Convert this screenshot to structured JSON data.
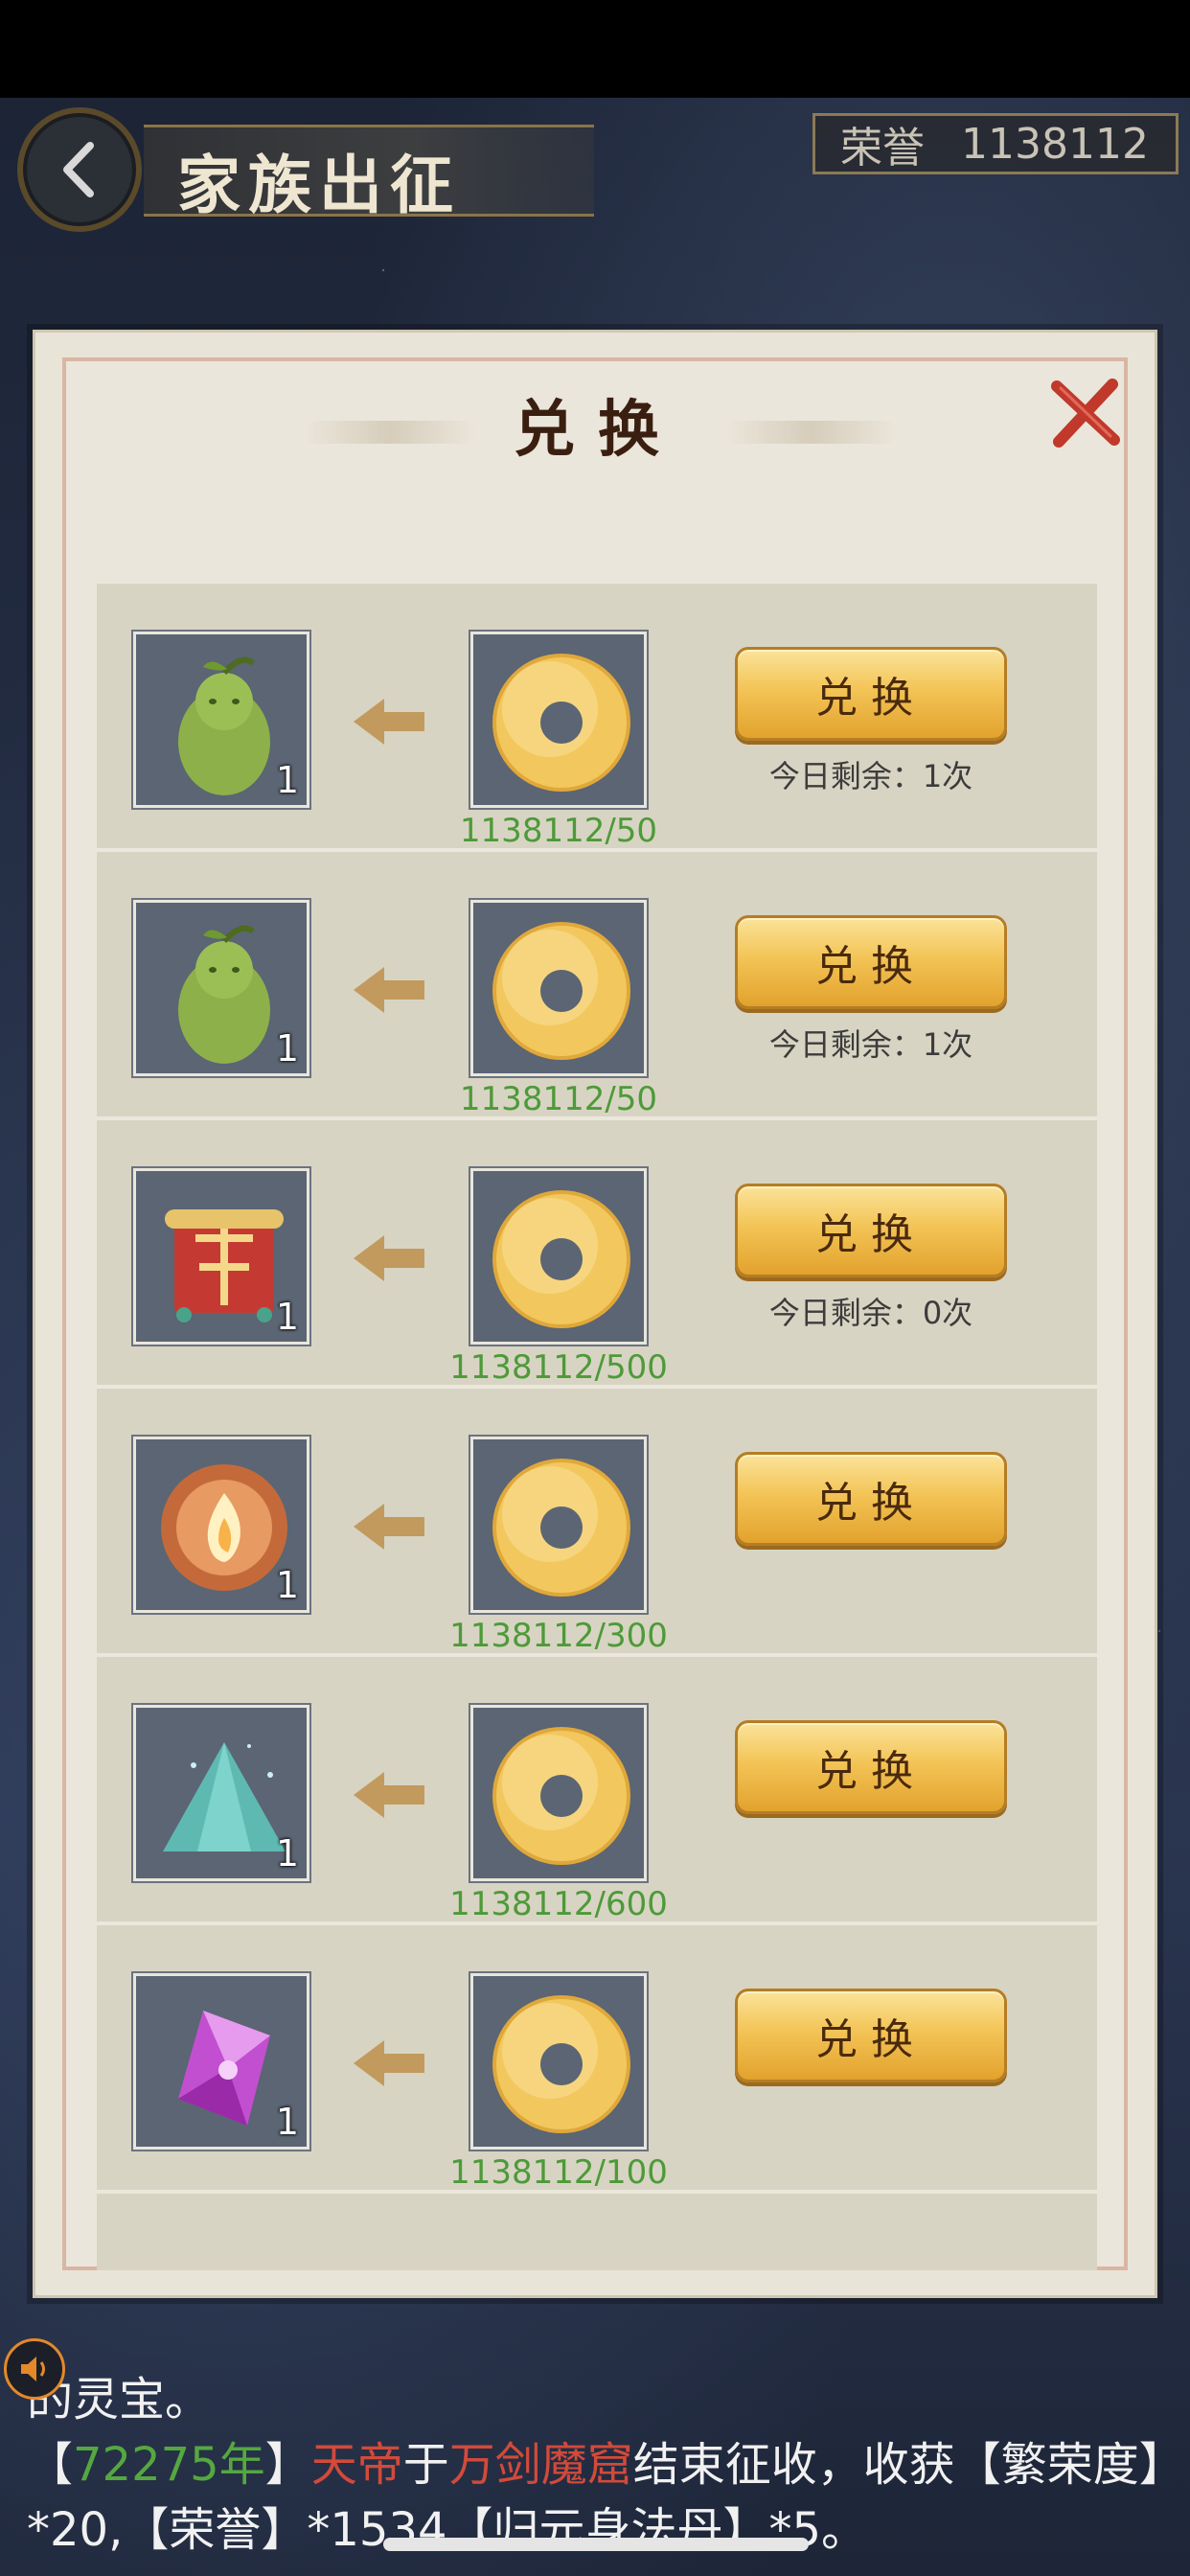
{
  "header": {
    "title": "家族出征",
    "honor_label": "荣誉",
    "honor_value": "1138112"
  },
  "dialog": {
    "title": "兑换",
    "rows": [
      {
        "qty": "1",
        "reward_icon": "pear-doll-icon",
        "cost": "1138112/50",
        "button": "兑换",
        "remaining": "今日剩余：1次"
      },
      {
        "qty": "1",
        "reward_icon": "pear-doll-icon",
        "cost": "1138112/50",
        "button": "兑换",
        "remaining": "今日剩余：1次"
      },
      {
        "qty": "1",
        "reward_icon": "scroll-banner-icon",
        "cost": "1138112/500",
        "button": "兑换",
        "remaining": "今日剩余：0次"
      },
      {
        "qty": "1",
        "reward_icon": "fire-orb-icon",
        "cost": "1138112/300",
        "button": "兑换",
        "remaining": ""
      },
      {
        "qty": "1",
        "reward_icon": "jade-pile-icon",
        "cost": "1138112/600",
        "button": "兑换",
        "remaining": ""
      },
      {
        "qty": "1",
        "reward_icon": "purple-crystal-icon",
        "cost": "1138112/100",
        "button": "兑换",
        "remaining": ""
      }
    ]
  },
  "chat": {
    "line1": "的灵宝。",
    "line2": {
      "open": "【",
      "year": "72275年",
      "close": "】",
      "actor": "天帝",
      "mid": "于",
      "place": "万剑魔窟",
      "rest": "结束征收，收获【繁荣度】"
    },
    "line3": "*20,【荣誉】*1534【归元身法丹】*5。"
  },
  "colors": {
    "cost_green": "#4d9a39",
    "button_gold": "#f3c456",
    "title_dark": "#3a1f10",
    "close_red": "#c0392b"
  }
}
